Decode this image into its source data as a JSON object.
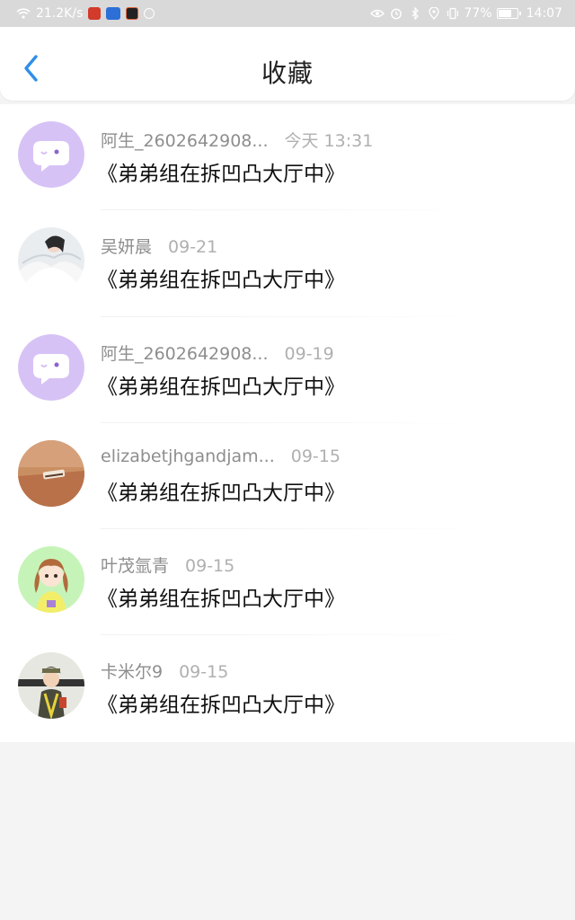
{
  "status_bar": {
    "net_speed": "21.2K/s",
    "battery": "77%",
    "battery_level": 0.77,
    "time": "14:07"
  },
  "header": {
    "title": "收藏"
  },
  "favorites": [
    {
      "name": "阿生_2602642908...",
      "time": "今天 13:31",
      "content": "《弟弟组在拆凹凸大厅中》",
      "avatar": "bubble"
    },
    {
      "name": "吴妍晨",
      "time": "09-21",
      "content": "《弟弟组在拆凹凸大厅中》",
      "avatar": "angel"
    },
    {
      "name": "阿生_2602642908...",
      "time": "09-19",
      "content": "《弟弟组在拆凹凸大厅中》",
      "avatar": "bubble"
    },
    {
      "name": "elizabetjhgandjam...",
      "time": "09-15",
      "content": "《弟弟组在拆凹凸大厅中》",
      "avatar": "desk"
    },
    {
      "name": "叶茂氩青",
      "time": "09-15",
      "content": "《弟弟组在拆凹凸大厅中》",
      "avatar": "girl"
    },
    {
      "name": "卡米尔9",
      "time": "09-15",
      "content": "《弟弟组在拆凹凸大厅中》",
      "avatar": "boy"
    }
  ],
  "colors": {
    "accent": "#2f8fe8",
    "bubble_avatar": "#d7c2f6"
  }
}
